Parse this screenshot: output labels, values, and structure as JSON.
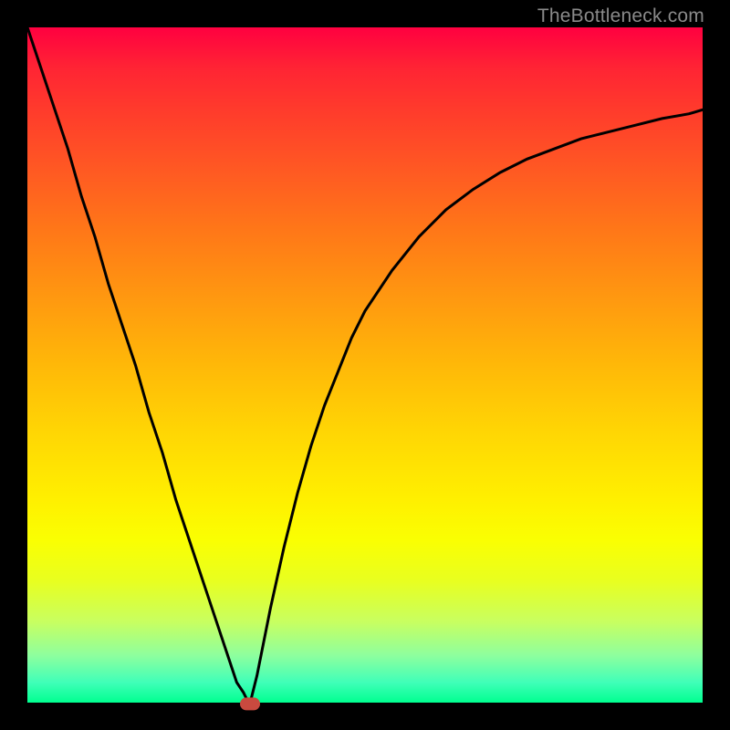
{
  "watermark": "TheBottleneck.com",
  "colors": {
    "frame": "#000000",
    "curve_stroke": "#000000",
    "marker_fill": "#c94a3f",
    "watermark_text": "#8a8a8a"
  },
  "chart_data": {
    "type": "line",
    "title": "",
    "xlabel": "",
    "ylabel": "",
    "xlim": [
      0,
      100
    ],
    "ylim": [
      0,
      100
    ],
    "grid": false,
    "legend": false,
    "note": "Axes are unlabeled in the image. Values below are estimates read from the curve: x is horizontal position as % of plot width (left→right), y is height as % of plot height (bottom→top). Two monotone branches meet at the minimum.",
    "series": [
      {
        "name": "left-branch",
        "x": [
          0,
          2,
          4,
          6,
          8,
          10,
          12,
          14,
          16,
          18,
          20,
          22,
          24,
          26,
          28,
          30,
          31,
          32,
          32.5,
          33
        ],
        "y": [
          100,
          94,
          88,
          82,
          75,
          69,
          62,
          56,
          50,
          43,
          37,
          30,
          24,
          18,
          12,
          6,
          3,
          1.5,
          0.5,
          0
        ]
      },
      {
        "name": "right-branch",
        "x": [
          33,
          34,
          35,
          36,
          38,
          40,
          42,
          44,
          46,
          48,
          50,
          54,
          58,
          62,
          66,
          70,
          74,
          78,
          82,
          86,
          90,
          94,
          98,
          100
        ],
        "y": [
          0,
          4,
          9,
          14,
          23,
          31,
          38,
          44,
          49,
          54,
          58,
          64,
          69,
          73,
          76,
          78.5,
          80.5,
          82,
          83.5,
          84.5,
          85.5,
          86.5,
          87.2,
          87.8
        ]
      }
    ],
    "marker": {
      "x_pct": 33,
      "y_pct": 0,
      "shape": "rounded-rect"
    }
  }
}
